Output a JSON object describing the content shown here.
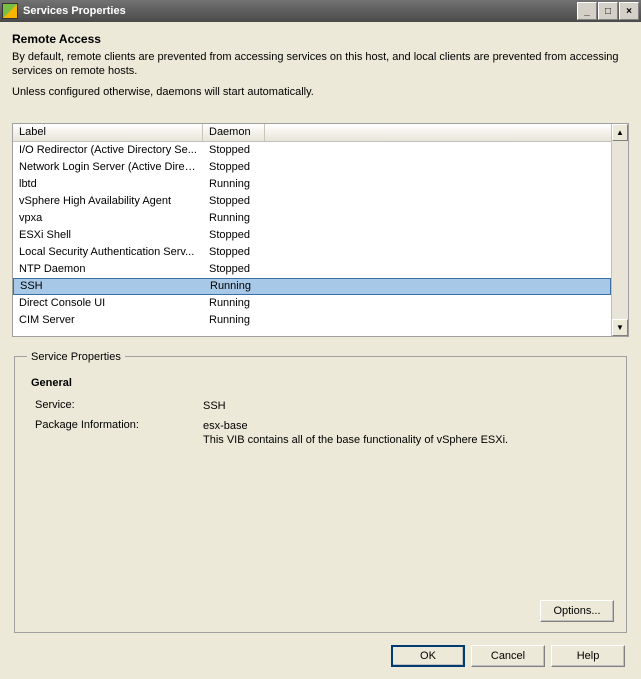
{
  "window": {
    "title": "Services Properties",
    "minimize": "_",
    "maximize": "□",
    "close": "×"
  },
  "section": {
    "title": "Remote Access",
    "desc1": "By default, remote clients are prevented from accessing services on this host, and local clients are prevented from accessing services on remote hosts.",
    "desc2": "Unless configured otherwise, daemons will start automatically."
  },
  "table": {
    "headers": {
      "label": "Label",
      "daemon": "Daemon"
    },
    "rows": [
      {
        "label": "I/O Redirector (Active Directory Se...",
        "daemon": "Stopped",
        "selected": false
      },
      {
        "label": "Network Login Server (Active Direc...",
        "daemon": "Stopped",
        "selected": false
      },
      {
        "label": "lbtd",
        "daemon": "Running",
        "selected": false
      },
      {
        "label": "vSphere High Availability Agent",
        "daemon": "Stopped",
        "selected": false
      },
      {
        "label": "vpxa",
        "daemon": "Running",
        "selected": false
      },
      {
        "label": "ESXi Shell",
        "daemon": "Stopped",
        "selected": false
      },
      {
        "label": "Local Security Authentication Serv...",
        "daemon": "Stopped",
        "selected": false
      },
      {
        "label": "NTP Daemon",
        "daemon": "Stopped",
        "selected": false
      },
      {
        "label": "SSH",
        "daemon": "Running",
        "selected": true
      },
      {
        "label": "Direct Console UI",
        "daemon": "Running",
        "selected": false
      },
      {
        "label": "CIM Server",
        "daemon": "Running",
        "selected": false
      }
    ]
  },
  "props": {
    "legend": "Service Properties",
    "general": "General",
    "service_label": "Service:",
    "service_value": "SSH",
    "pkg_label": "Package Information:",
    "pkg_name": "esx-base",
    "pkg_desc": "This VIB contains all of the base functionality of vSphere ESXi.",
    "options_btn": "Options..."
  },
  "buttons": {
    "ok": "OK",
    "cancel": "Cancel",
    "help": "Help"
  }
}
